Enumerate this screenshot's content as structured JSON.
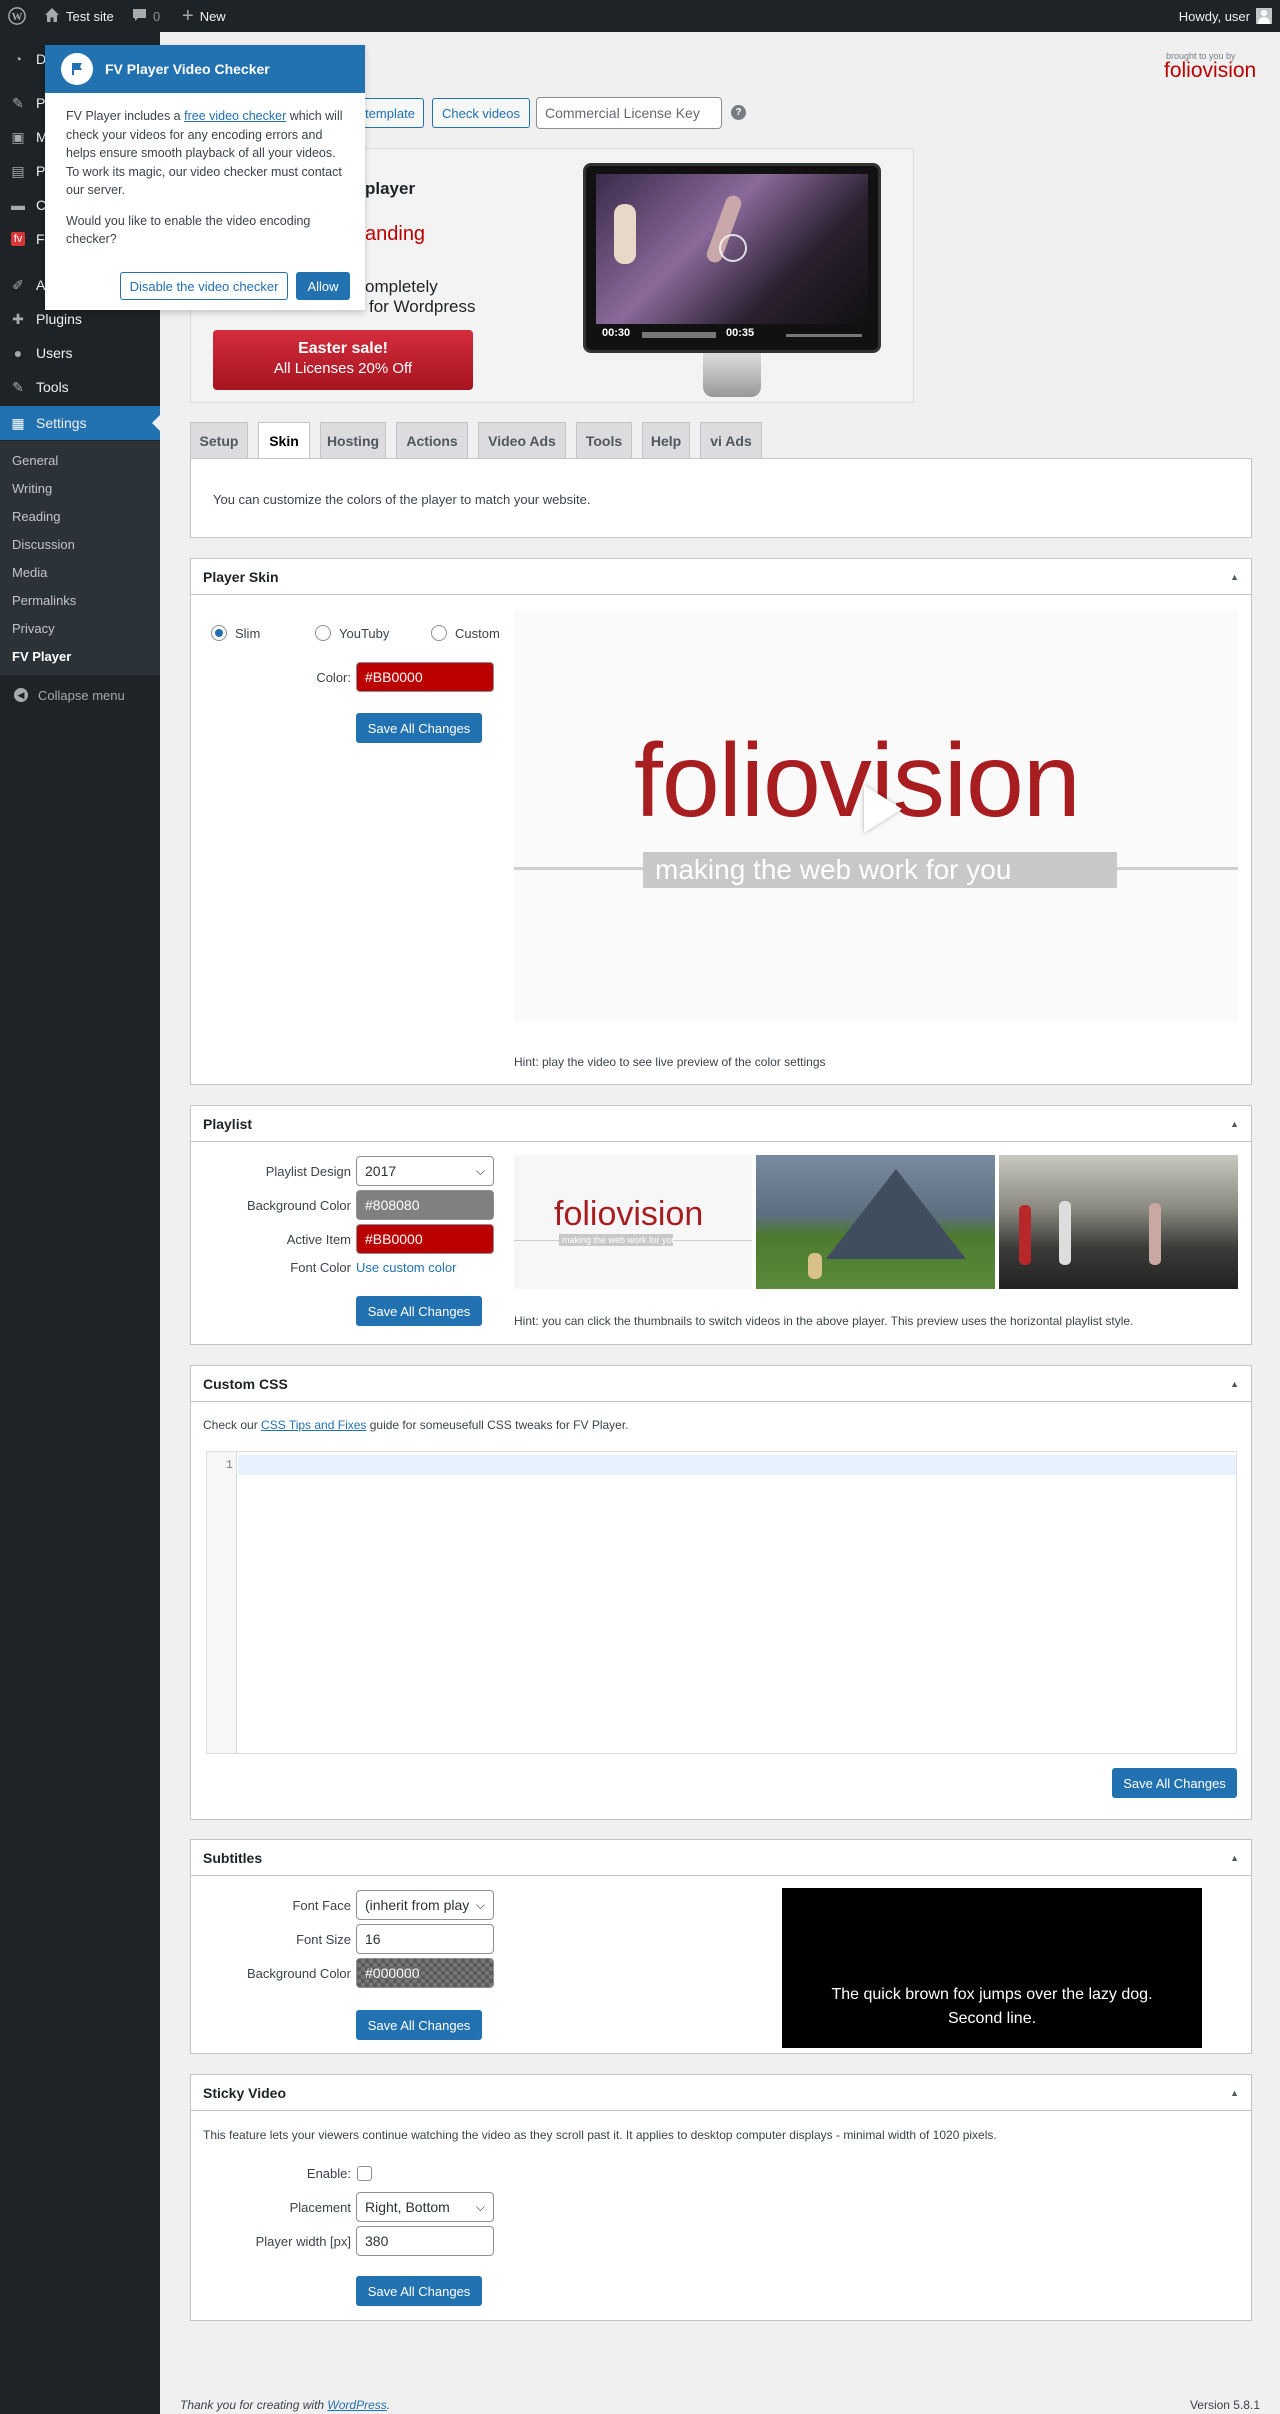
{
  "adminbar": {
    "site": "Test site",
    "comments": "0",
    "new": "New",
    "howdy": "Howdy, user"
  },
  "sidebar": {
    "items": [
      {
        "label": "D",
        "icon": "dashboard-icon"
      },
      {
        "label": "P",
        "icon": "pin-icon"
      },
      {
        "label": "M",
        "icon": "media-icon"
      },
      {
        "label": "P",
        "icon": "pages-icon"
      },
      {
        "label": "C",
        "icon": "comments-icon"
      },
      {
        "label": "F",
        "icon": "fv-icon"
      },
      {
        "label": "A",
        "icon": "appearance-icon"
      },
      {
        "label": "Plugins",
        "icon": "plugins-icon"
      },
      {
        "label": "Users",
        "icon": "users-icon"
      },
      {
        "label": "Tools",
        "icon": "tools-icon"
      },
      {
        "label": "Settings",
        "icon": "settings-icon"
      }
    ],
    "submenu": [
      "General",
      "Writing",
      "Reading",
      "Discussion",
      "Media",
      "Permalinks",
      "Privacy",
      "FV Player"
    ],
    "collapse": "Collapse menu"
  },
  "popup": {
    "title": "FV Player Video Checker",
    "p1a": "FV Player includes a ",
    "p1link": "free video checker",
    "p1b": " which will check your videos for any encoding errors and helps ensure smooth playback of all your videos. To work its magic, our video checker must contact our server.",
    "p2": "Would you like to enable the video encoding checker?",
    "disable": "Disable the video checker",
    "allow": "Allow"
  },
  "header": {
    "template_btn": "template",
    "check_btn": "Check videos",
    "license_placeholder": "Commercial License Key",
    "help": "?",
    "brand_small": "brought to you by",
    "brand": "foliovision"
  },
  "promo": {
    "line1": "player",
    "line2": "anding",
    "line3": "ompletely",
    "line4": "for Wordpress",
    "sale1": "Easter sale!",
    "sale2": "All Licenses 20% Off",
    "time1": "00:30",
    "time2": "00:35"
  },
  "tabs": [
    "Setup",
    "Skin",
    "Hosting",
    "Actions",
    "Video Ads",
    "Tools",
    "Help",
    "vi Ads"
  ],
  "intro": "You can customize the colors of the player to match your website.",
  "skin": {
    "title": "Player Skin",
    "options": [
      "Slim",
      "YouTuby",
      "Custom"
    ],
    "color_label": "Color:",
    "color_value": "#BB0000",
    "save": "Save All Changes",
    "logo": "foliovision",
    "tagline": "making the web work for you",
    "hint": "Hint: play the video to see live preview of the color settings"
  },
  "playlist": {
    "title": "Playlist",
    "design_label": "Playlist Design",
    "design_value": "2017",
    "bg_label": "Background Color",
    "bg_value": "#808080",
    "active_label": "Active Item",
    "active_value": "#BB0000",
    "font_label": "Font Color",
    "font_value": "Use custom color",
    "save": "Save All Changes",
    "thumb_logo": "foliovision",
    "thumb_tag": "making the web work for you",
    "hint": "Hint: you can click the thumbnails to switch videos in the above player. This preview uses the horizontal playlist style."
  },
  "css": {
    "title": "Custom CSS",
    "desc_a": "Check our ",
    "desc_link": "CSS Tips and Fixes",
    "desc_b": " guide for someusefull CSS tweaks for FV Player.",
    "line": "1",
    "save": "Save All Changes"
  },
  "subtitles": {
    "title": "Subtitles",
    "face_label": "Font Face",
    "face_value": "(inherit from play",
    "size_label": "Font Size",
    "size_value": "16",
    "bg_label": "Background Color",
    "bg_value": "#000000",
    "save": "Save All Changes",
    "preview1": "The quick brown fox jumps over the lazy dog.",
    "preview2": "Second line."
  },
  "sticky": {
    "title": "Sticky Video",
    "desc": "This feature lets your viewers continue watching the video as they scroll past it. It applies to desktop computer displays - minimal width of 1020 pixels.",
    "enable_label": "Enable:",
    "placement_label": "Placement",
    "placement_value": "Right, Bottom",
    "width_label": "Player width [px]",
    "width_value": "380",
    "save": "Save All Changes"
  },
  "footer": {
    "thanks": "Thank you for creating with ",
    "wp": "WordPress",
    "dot": ".",
    "version": "Version 5.8.1"
  }
}
